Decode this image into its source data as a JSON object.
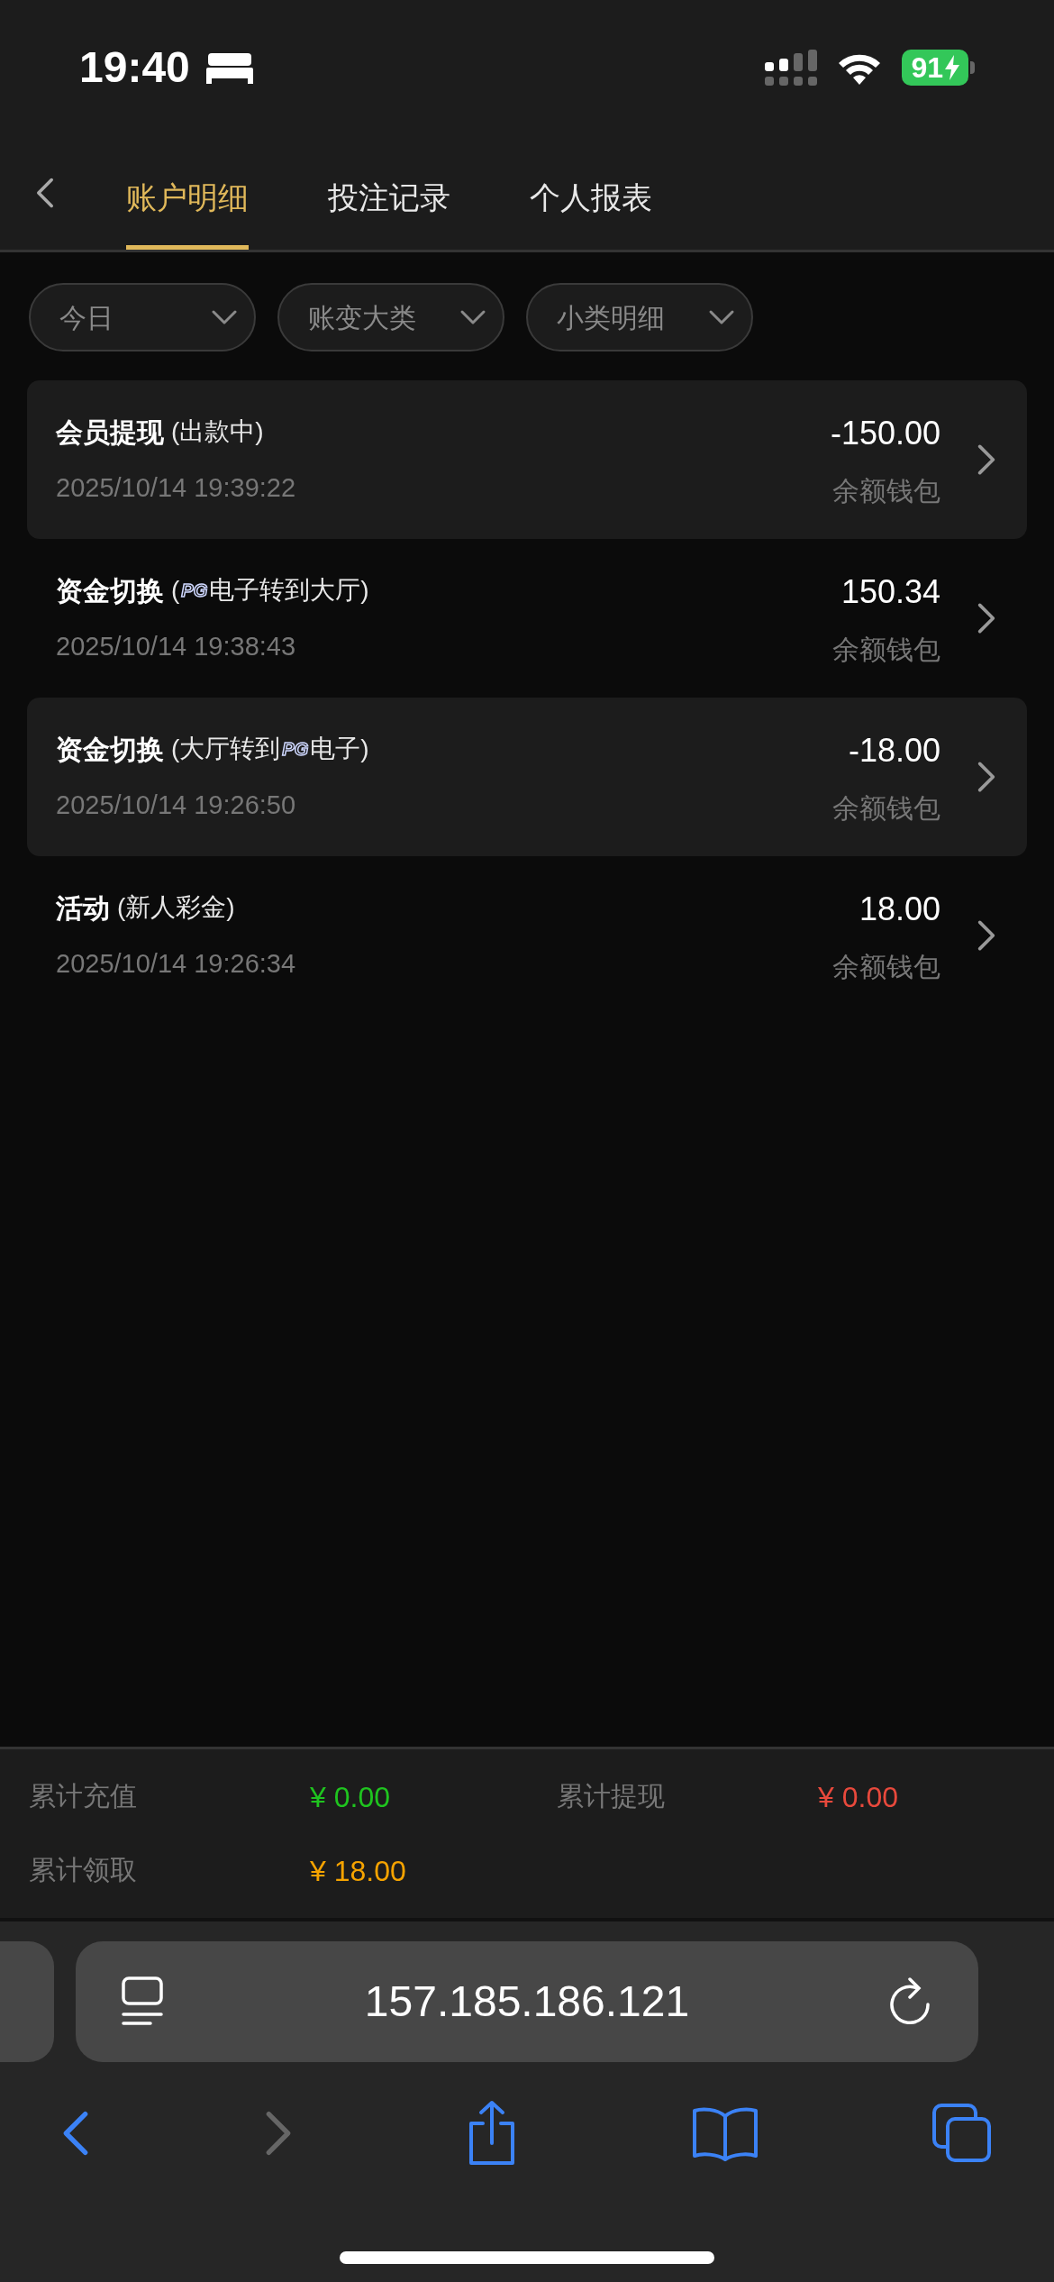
{
  "status_bar": {
    "time": "19:40",
    "battery": "91"
  },
  "tabs": [
    {
      "label": "账户明细",
      "selected": true
    },
    {
      "label": "投注记录",
      "selected": false
    },
    {
      "label": "个人报表",
      "selected": false
    }
  ],
  "filters": [
    {
      "label": "今日"
    },
    {
      "label": "账变大类"
    },
    {
      "label": "小类明细"
    }
  ],
  "records": [
    {
      "title": "会员提现",
      "detail": [
        {
          "kind": "text",
          "text": "(出款中)"
        }
      ],
      "time": "2025/10/14 19:39:22",
      "amount": "-150.00",
      "wallet": "余额钱包"
    },
    {
      "title": "资金切换",
      "detail": [
        {
          "kind": "text",
          "text": "("
        },
        {
          "kind": "logo",
          "text": "PG"
        },
        {
          "kind": "text",
          "text": "电子转到大厅)"
        }
      ],
      "time": "2025/10/14 19:38:43",
      "amount": "150.34",
      "wallet": "余额钱包"
    },
    {
      "title": "资金切换",
      "detail": [
        {
          "kind": "text",
          "text": "(大厅转到"
        },
        {
          "kind": "logo",
          "text": "PG"
        },
        {
          "kind": "text",
          "text": "电子)"
        }
      ],
      "time": "2025/10/14 19:26:50",
      "amount": "-18.00",
      "wallet": "余额钱包"
    },
    {
      "title": "活动",
      "detail": [
        {
          "kind": "text",
          "text": "(新人彩金)"
        }
      ],
      "time": "2025/10/14 19:26:34",
      "amount": "18.00",
      "wallet": "余额钱包"
    }
  ],
  "summary": [
    {
      "label": "累计充值",
      "value": "¥ 0.00",
      "color": "#1fc41f"
    },
    {
      "label": "累计提现",
      "value": "¥ 0.00",
      "color": "#e8493c"
    },
    {
      "label": "累计领取",
      "value": "¥ 18.00",
      "color": "#f5a300"
    }
  ],
  "browser": {
    "url": "157.185.186.121"
  }
}
